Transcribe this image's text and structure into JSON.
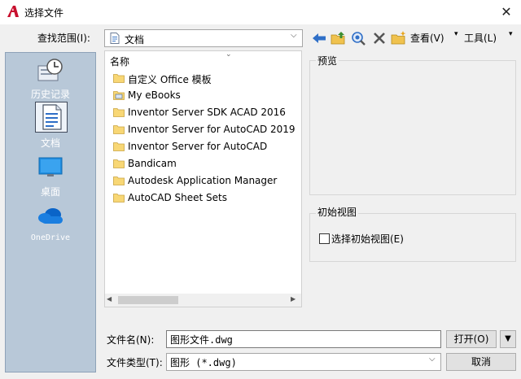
{
  "window": {
    "title": "选择文件",
    "close_glyph": "✕"
  },
  "lookin": {
    "label": "查找范围(I):",
    "value": "文档",
    "icon": "document-icon"
  },
  "toolbar": {
    "items": [
      "back-icon",
      "up-folder-icon",
      "search-web-icon",
      "delete-icon",
      "new-folder-icon"
    ],
    "view_label": "查看(V)",
    "tools_label": "工具(L)"
  },
  "places": [
    {
      "label": "历史记录",
      "icon": "history-icon"
    },
    {
      "label": "文档",
      "icon": "documents-icon",
      "selected": true
    },
    {
      "label": "桌面",
      "icon": "desktop-icon"
    },
    {
      "label": "OneDrive",
      "icon": "onedrive-icon"
    }
  ],
  "filelist": {
    "column_header": "名称",
    "items": [
      {
        "name": "自定义 Office 模板",
        "icon": "folder-icon"
      },
      {
        "name": "My eBooks",
        "icon": "ebook-folder-icon"
      },
      {
        "name": "Inventor Server SDK ACAD 2016",
        "icon": "folder-icon"
      },
      {
        "name": "Inventor Server for AutoCAD 2019",
        "icon": "folder-icon"
      },
      {
        "name": "Inventor Server for AutoCAD",
        "icon": "folder-icon"
      },
      {
        "name": "Bandicam",
        "icon": "folder-icon"
      },
      {
        "name": "Autodesk Application Manager",
        "icon": "folder-icon"
      },
      {
        "name": "AutoCAD Sheet Sets",
        "icon": "folder-icon"
      }
    ]
  },
  "preview": {
    "label": "预览"
  },
  "initial_view": {
    "label": "初始视图",
    "checkbox_label": "选择初始视图(E)",
    "checked": false
  },
  "bottom": {
    "filename_label": "文件名(N):",
    "filename_value": "图形文件.dwg",
    "filetype_label": "文件类型(T):",
    "filetype_value": "图形 (*.dwg)",
    "open_label": "打开(O)",
    "cancel_label": "取消"
  },
  "colors": {
    "places_bg": "#b8c8d8",
    "folder": "#f8d775",
    "accent": "#2f6fc7"
  }
}
